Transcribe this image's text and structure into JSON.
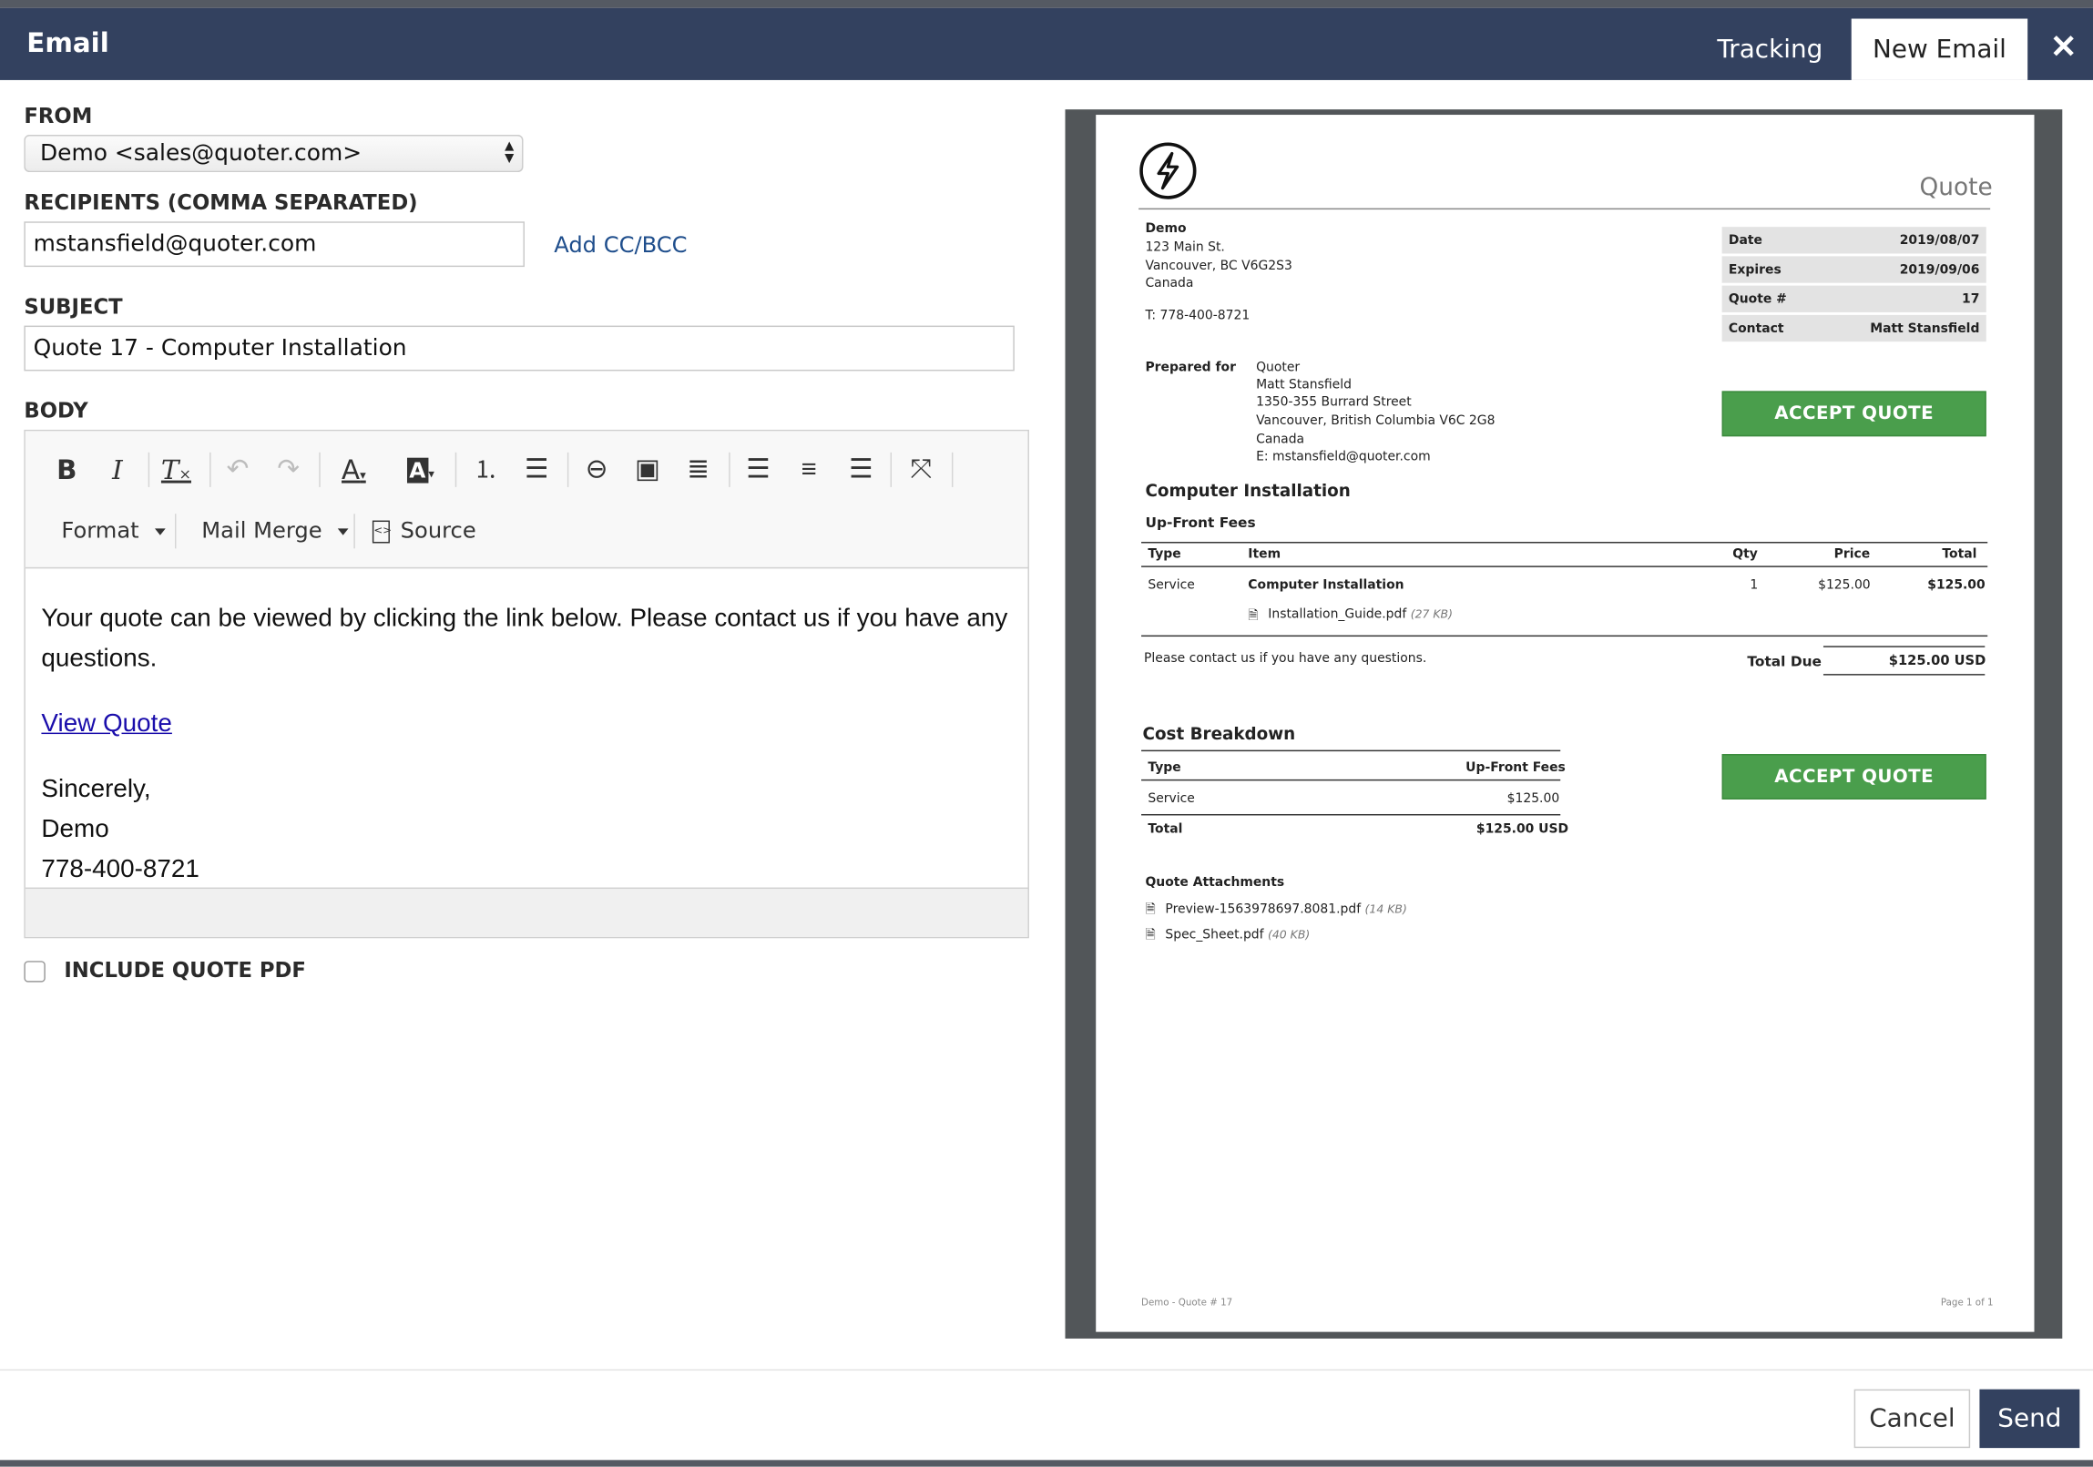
{
  "dialog": {
    "title": "Email",
    "tabs": [
      {
        "label": "Tracking",
        "active": false
      },
      {
        "label": "New Email",
        "active": true
      }
    ],
    "close_icon": "close-icon",
    "header_color": "#33415f"
  },
  "form": {
    "from_label": "FROM",
    "from_value": "Demo <sales@quoter.com>",
    "recipients_label": "RECIPIENTS (COMMA SEPARATED)",
    "recipients_value": "mstansfield@quoter.com",
    "add_cc_bcc": "Add CC/BCC",
    "subject_label": "SUBJECT",
    "subject_value": "Quote 17 - Computer Installation",
    "body_label": "BODY",
    "include_pdf_label": "INCLUDE QUOTE PDF",
    "include_pdf_checked": false
  },
  "toolbar": {
    "buttons": [
      "bold-icon",
      "italic-icon",
      "remove-format-icon",
      "undo-icon",
      "redo-icon",
      "text-color-icon",
      "background-color-icon",
      "numbered-list-icon",
      "bulleted-list-icon",
      "link-icon",
      "image-icon",
      "horizontal-line-icon",
      "align-left-icon",
      "align-center-icon",
      "align-right-icon",
      "maximize-icon"
    ],
    "format_label": "Format",
    "mail_merge_label": "Mail Merge",
    "source_label": "Source"
  },
  "email_body": {
    "paragraph": "Your quote can be viewed by clicking the link below. Please contact us if you have any questions.",
    "link_text": "View Quote",
    "sign_off": "Sincerely,",
    "sender_name": "Demo",
    "sender_phone": "778-400-8721"
  },
  "quote": {
    "doc_title": "Quote",
    "company": {
      "name": "Demo",
      "address1": "123 Main St.",
      "address2": "Vancouver, BC V6G2S3",
      "country": "Canada",
      "phone": "T: 778-400-8721"
    },
    "meta": [
      {
        "label": "Date",
        "value": "2019/08/07"
      },
      {
        "label": "Expires",
        "value": "2019/09/06"
      },
      {
        "label": "Quote #",
        "value": "17"
      },
      {
        "label": "Contact",
        "value": "Matt Stansfield"
      }
    ],
    "prepared_for_label": "Prepared for",
    "prepared_for": [
      "Quoter",
      "Matt Stansfield",
      "1350-355 Burrard Street",
      "Vancouver, British Columbia V6C 2G8",
      "Canada",
      "E: mstansfield@quoter.com"
    ],
    "accept_label": "ACCEPT QUOTE",
    "accept_color": "#4a9e4c",
    "section_title": "Computer Installation",
    "fees_title": "Up-Front Fees",
    "columns": {
      "type": "Type",
      "item": "Item",
      "qty": "Qty",
      "price": "Price",
      "total": "Total"
    },
    "line_item": {
      "type": "Service",
      "item": "Computer Installation",
      "qty": "1",
      "price": "$125.00",
      "total": "$125.00",
      "attachment": "Installation_Guide.pdf",
      "attachment_size": "(27 KB)"
    },
    "contact_note": "Please contact us if you have any questions.",
    "total_due_label": "Total Due",
    "total_due_value": "$125.00 USD",
    "breakdown": {
      "title": "Cost Breakdown",
      "col_type": "Type",
      "col_fees": "Up-Front Fees",
      "row_type": "Service",
      "row_value": "$125.00",
      "total_label": "Total",
      "total_value": "$125.00 USD"
    },
    "attachments_title": "Quote Attachments",
    "attachments": [
      {
        "name": "Preview-1563978697.8081.pdf",
        "size": "(14 KB)"
      },
      {
        "name": "Spec_Sheet.pdf",
        "size": "(40 KB)"
      }
    ],
    "footer_left": "Demo - Quote # 17",
    "footer_right": "Page 1 of 1"
  },
  "actions": {
    "cancel": "Cancel",
    "send": "Send"
  }
}
